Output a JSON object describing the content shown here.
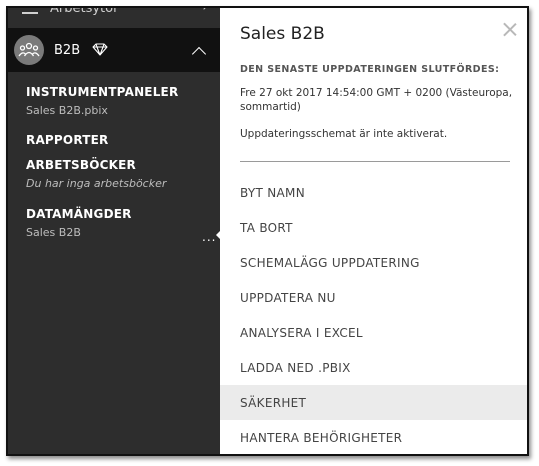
{
  "sidebar": {
    "top_item_label": "Arbetsytor",
    "workspace": {
      "name": "B2B"
    },
    "sections": [
      {
        "heading": "INSTRUMENTPANELER",
        "sub": "Sales B2B.pbix"
      },
      {
        "heading": "RAPPORTER"
      },
      {
        "heading": "ARBETSBÖCKER",
        "sub": "Du har inga arbetsböcker"
      },
      {
        "heading": "DATAMÄNGDER",
        "sub": "Sales B2B"
      }
    ],
    "more_label": "..."
  },
  "panel": {
    "title": "Sales B2B",
    "update_label": "DEN SENASTE UPPDATERINGEN SLUTFÖRDES:",
    "update_time": "Fre 27 okt 2017 14:54:00 GMT + 0200 (Västeuropa, sommartid)",
    "schedule_status": "Uppdateringsschemat är inte aktiverat.",
    "menu": [
      "BYT NAMN",
      "TA BORT",
      "SCHEMALÄGG UPPDATERING",
      "UPPDATERA NU",
      "ANALYSERA I EXCEL",
      "LADDA NED .PBIX",
      "SÄKERHET",
      "HANTERA BEHÖRIGHETER"
    ],
    "active_index": 6
  }
}
